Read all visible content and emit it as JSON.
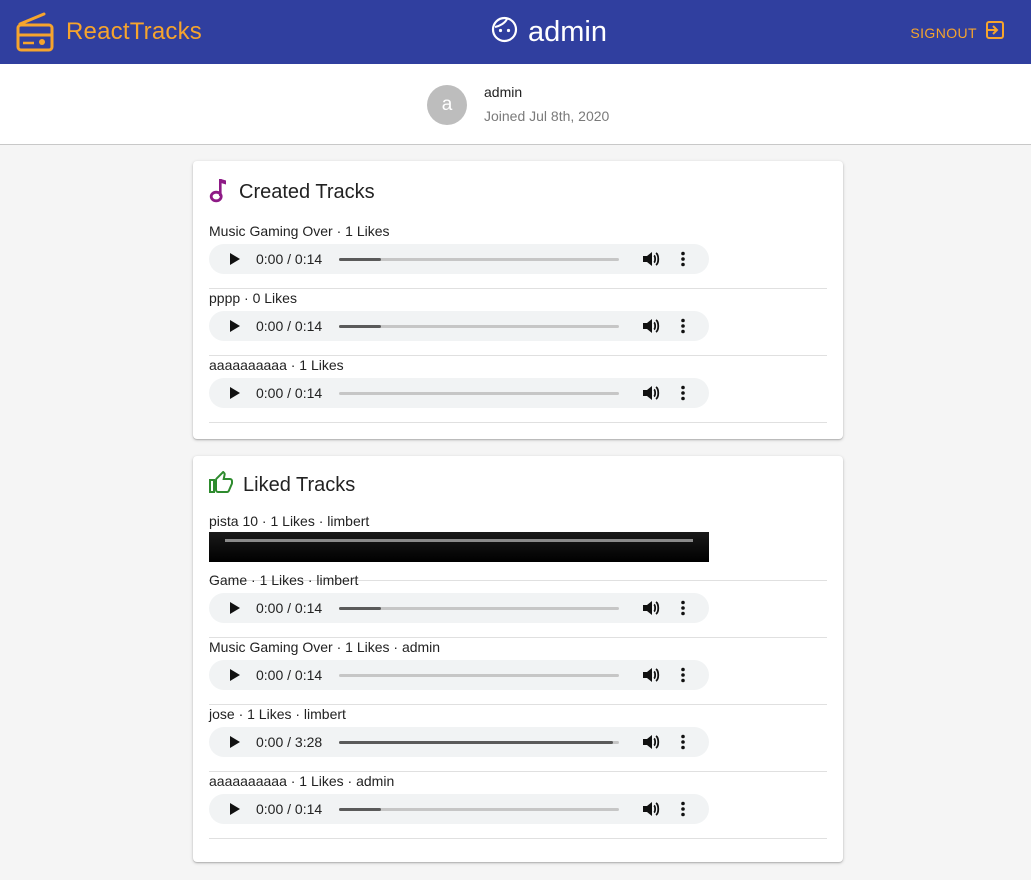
{
  "app": {
    "brand": "ReactTracks",
    "brand_color": "#f6a42d",
    "appbar_color": "#303f9f",
    "header_username": "admin",
    "signout_label": "SIGNOUT"
  },
  "profile": {
    "avatar_letter": "a",
    "username": "admin",
    "joined": "Joined Jul 8th, 2020"
  },
  "created": {
    "title": "Created Tracks",
    "icon": "music-note-icon",
    "icon_color": "#8e1a86",
    "tracks": [
      {
        "meta": "Music Gaming Over · 1 Likes",
        "time": "0:00 / 0:14",
        "progress": 0.15
      },
      {
        "meta": "pppp · 0 Likes",
        "time": "0:00 / 0:14",
        "progress": 0.15
      },
      {
        "meta": "aaaaaaaaaa · 1 Likes",
        "time": "0:00 / 0:14",
        "progress": 0
      }
    ]
  },
  "liked": {
    "title": "Liked Tracks",
    "icon": "thumb-up-icon",
    "icon_color": "#2e8b2e",
    "tracks": [
      {
        "meta": "pista 10 · 1 Likes · limbert",
        "player": "video"
      },
      {
        "meta": "Game · 1 Likes · limbert",
        "time": "0:00 / 0:14",
        "progress": 0.15
      },
      {
        "meta": "Music Gaming Over · 1 Likes · admin",
        "time": "0:00 / 0:14",
        "progress": 0
      },
      {
        "meta": "jose · 1 Likes · limbert",
        "time": "0:00 / 3:28",
        "progress": 0.98
      },
      {
        "meta": "aaaaaaaaaa · 1 Likes · admin",
        "time": "0:00 / 0:14",
        "progress": 0.15
      }
    ]
  }
}
